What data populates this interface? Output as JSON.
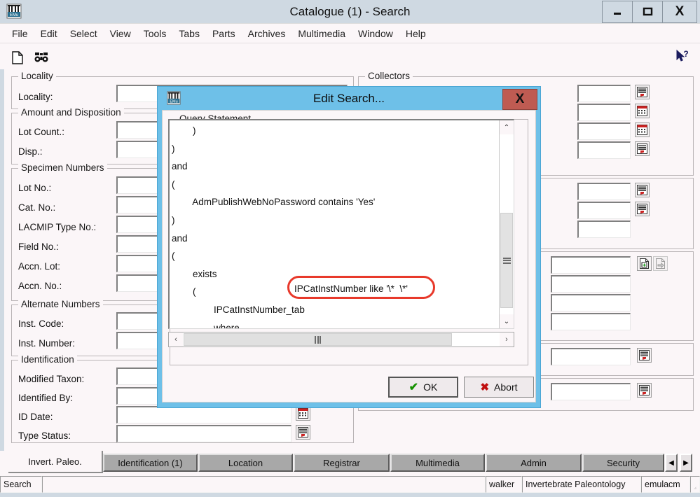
{
  "window": {
    "title": "Catalogue (1) - Search",
    "icon": "emu-museum-icon",
    "minimize": "–",
    "maximize": "❑",
    "close": "X"
  },
  "menubar": {
    "items": [
      "File",
      "Edit",
      "Select",
      "View",
      "Tools",
      "Tabs",
      "Parts",
      "Archives",
      "Multimedia",
      "Window",
      "Help"
    ]
  },
  "toolbar": {
    "new_record_icon": "page-icon",
    "search_icon": "binoculars-icon",
    "help_icon": "whats-this-help-icon"
  },
  "form": {
    "groups": [
      {
        "title": "Locality",
        "fields": [
          {
            "label": "Locality:",
            "value": ""
          }
        ]
      },
      {
        "title": "Amount and Disposition",
        "fields": [
          {
            "label": "Lot Count.:",
            "value": ""
          },
          {
            "label": "Disp.:",
            "value": ""
          }
        ]
      },
      {
        "title": "Specimen Numbers",
        "fields": [
          {
            "label": "Lot No.:",
            "value": ""
          },
          {
            "label": "Cat. No.:",
            "value": ""
          },
          {
            "label": "LACMIP Type No.:",
            "value": ""
          },
          {
            "label": "Field No.:",
            "value": ""
          },
          {
            "label": "Accn. Lot:",
            "value": ""
          },
          {
            "label": "Accn. No.:",
            "value": ""
          }
        ]
      },
      {
        "title": "Alternate Numbers",
        "fields": [
          {
            "label": "Inst. Code:",
            "value": ""
          },
          {
            "label": "Inst. Number:",
            "value": ""
          }
        ]
      },
      {
        "title": "Identification",
        "fields": [
          {
            "label": "Modified Taxon:",
            "value": ""
          },
          {
            "label": "Identified By:",
            "value": ""
          },
          {
            "label": "ID Date:",
            "value": ""
          },
          {
            "label": "Type Status:",
            "value": ""
          }
        ]
      }
    ],
    "right_groups": [
      {
        "title": "Collectors"
      },
      {
        "title": ""
      },
      {
        "title": ""
      },
      {
        "title": ""
      },
      {
        "title": ""
      }
    ],
    "right_field_icons": [
      "lookup-list-icon",
      "calendar-icon",
      "calendar-icon",
      "lookup-list-icon",
      "lookup-list-icon",
      "lookup-list-icon",
      "attach-add-icon",
      "attach-goto-icon",
      "lookup-list-icon",
      "lookup-list-icon"
    ]
  },
  "dialog": {
    "title": "Edit Search...",
    "icon": "emu-museum-icon",
    "close_label": "X",
    "group_label": "Query Statement",
    "query_text": "        )\n)\nand\n(\n        AdmPublishWebNoPassword contains 'Yes'\n)\nand\n(\n        exists\n        (\n                IPCatInstNumber_tab\n                where\n                (\n                )\n        )\n)|",
    "highlighted_condition": "IPCatInstNumber like '\\*  \\*'",
    "scroll": {
      "up_arrow": "⌃",
      "down_arrow": "⌄",
      "left_arrow": "‹",
      "right_arrow": "›"
    },
    "buttons": {
      "ok": "OK",
      "abort": "Abort",
      "ok_icon": "green-check-icon",
      "abort_icon": "red-x-icon"
    }
  },
  "tabs": {
    "active": "Invert. Paleo.",
    "items": [
      "Identification (1)",
      "Location",
      "Registrar",
      "Multimedia",
      "Admin",
      "Security"
    ],
    "scroll_left": "◀",
    "scroll_right": "▶"
  },
  "statusbar": {
    "mode": "Search",
    "message": "",
    "user": "walker",
    "department": "Invertebrate Paleontology",
    "server": "emulacm"
  },
  "colors": {
    "dialog_title_bg": "#6ec0e8",
    "dialog_close_bg": "#bf5b52",
    "window_chrome": "#cfd9e2",
    "form_bg": "#fbf6f8",
    "annotation": "#e8392b",
    "tab_inactive": "#a8a8a8"
  }
}
